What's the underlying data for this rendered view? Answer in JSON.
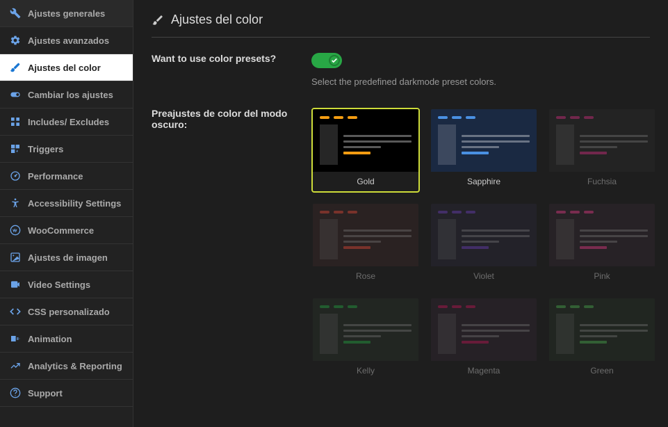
{
  "sidebar": {
    "items": [
      {
        "label": "Ajustes generales",
        "icon": "wrench"
      },
      {
        "label": "Ajustes avanzados",
        "icon": "gear"
      },
      {
        "label": "Ajustes del color",
        "icon": "brush"
      },
      {
        "label": "Cambiar los ajustes",
        "icon": "toggle"
      },
      {
        "label": "Includes/ Excludes",
        "icon": "layout"
      },
      {
        "label": "Triggers",
        "icon": "bolt"
      },
      {
        "label": "Performance",
        "icon": "gauge"
      },
      {
        "label": "Accessibility Settings",
        "icon": "accessibility"
      },
      {
        "label": "WooCommerce",
        "icon": "woo"
      },
      {
        "label": "Ajustes de imagen",
        "icon": "image"
      },
      {
        "label": "Video Settings",
        "icon": "video"
      },
      {
        "label": "CSS personalizado",
        "icon": "code"
      },
      {
        "label": "Animation",
        "icon": "animation"
      },
      {
        "label": "Analytics & Reporting",
        "icon": "analytics"
      },
      {
        "label": "Support",
        "icon": "support"
      }
    ],
    "activeIndex": 2
  },
  "header": {
    "title": "Ajustes del color"
  },
  "settings": {
    "presets_toggle_label": "Want to use color presets?",
    "presets_help": "Select the predefined darkmode preset colors.",
    "presets_label": "Preajustes de color del modo oscuro:"
  },
  "presets": [
    {
      "name": "Gold",
      "bg": "#000000",
      "accent": "#f39c12",
      "selected": true,
      "dimmed": false
    },
    {
      "name": "Sapphire",
      "bg": "#1a2942",
      "accent": "#4a90e2",
      "selected": false,
      "dimmed": false
    },
    {
      "name": "Fuchsia",
      "bg": "#2b2b2b",
      "accent": "#d63384",
      "selected": false,
      "dimmed": true
    },
    {
      "name": "Rose",
      "bg": "#3a2828",
      "accent": "#e74c3c",
      "selected": false,
      "dimmed": true
    },
    {
      "name": "Violet",
      "bg": "#2b2838",
      "accent": "#6f42c1",
      "selected": false,
      "dimmed": true
    },
    {
      "name": "Pink",
      "bg": "#332830",
      "accent": "#e83e8c",
      "selected": false,
      "dimmed": true
    },
    {
      "name": "Kelly",
      "bg": "#283028",
      "accent": "#28a745",
      "selected": false,
      "dimmed": true
    },
    {
      "name": "Magenta",
      "bg": "#302530",
      "accent": "#c2185b",
      "selected": false,
      "dimmed": true
    },
    {
      "name": "Green",
      "bg": "#253025",
      "accent": "#4caf50",
      "selected": false,
      "dimmed": true
    }
  ]
}
